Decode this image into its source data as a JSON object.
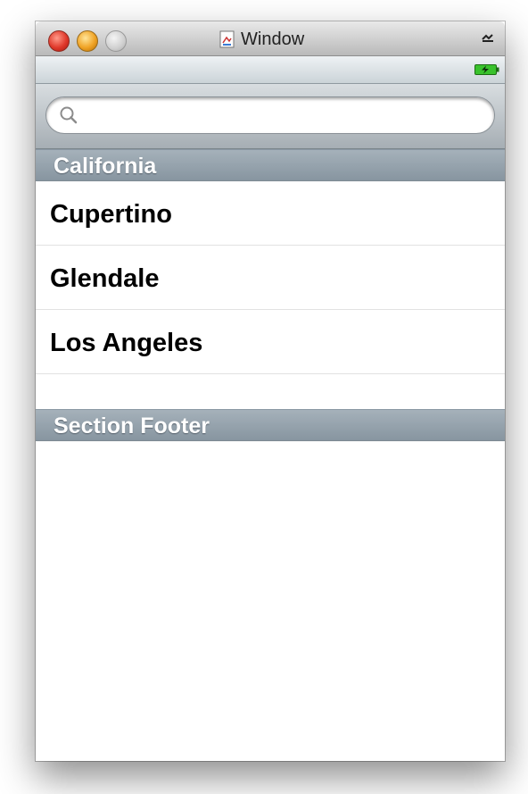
{
  "window": {
    "title": "Window",
    "toolbar_toggle_icon": "toolbar-toggle-icon",
    "document_icon": "document-icon"
  },
  "status": {
    "battery_icon": "battery-charging-icon",
    "battery_color": "#39c22c"
  },
  "search": {
    "placeholder": "",
    "value": "",
    "icon": "search-icon"
  },
  "table": {
    "section_header": "California",
    "rows": [
      {
        "label": "Cupertino"
      },
      {
        "label": "Glendale"
      },
      {
        "label": "Los Angeles"
      }
    ],
    "section_footer": "Section Footer"
  },
  "colors": {
    "close": "#e0392b",
    "minimize": "#f0a325",
    "zoom": "#cfcfcf",
    "section_header_bg": "#96a3ad"
  }
}
